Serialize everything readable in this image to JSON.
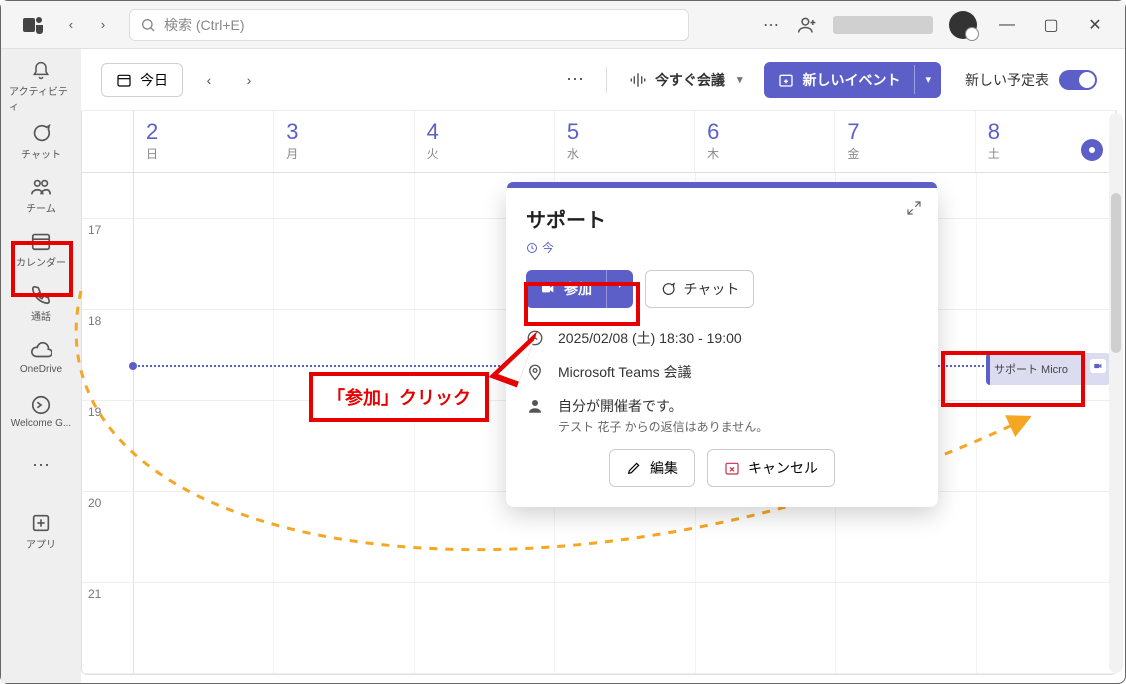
{
  "titlebar": {
    "search_placeholder": "検索 (Ctrl+E)"
  },
  "rail": {
    "items": [
      {
        "label": "アクティビティ",
        "name": "activity"
      },
      {
        "label": "チャット",
        "name": "chat"
      },
      {
        "label": "チーム",
        "name": "teams"
      },
      {
        "label": "カレンダー",
        "name": "calendar"
      },
      {
        "label": "通話",
        "name": "calls"
      },
      {
        "label": "OneDrive",
        "name": "onedrive"
      },
      {
        "label": "Welcome G...",
        "name": "welcome"
      }
    ],
    "apps_label": "アプリ"
  },
  "toolbar": {
    "today": "今日",
    "meet_now": "今すぐ会議",
    "new_event": "新しいイベント",
    "schedule_view": "新しい予定表"
  },
  "days": [
    {
      "num": "2",
      "dow": "日"
    },
    {
      "num": "3",
      "dow": "月"
    },
    {
      "num": "4",
      "dow": "火"
    },
    {
      "num": "5",
      "dow": "水"
    },
    {
      "num": "6",
      "dow": "木"
    },
    {
      "num": "7",
      "dow": "金"
    },
    {
      "num": "8",
      "dow": "土"
    }
  ],
  "hours": [
    "17",
    "18",
    "19",
    "20",
    "21"
  ],
  "event_block": {
    "title": "サポート Micro"
  },
  "popup": {
    "title": "サポート",
    "when_pill": "今",
    "join": "参加",
    "chat": "チャット",
    "datetime": "2025/02/08 (土) 18:30 - 19:00",
    "location": "Microsoft Teams 会議",
    "organizer_line": "自分が開催者です。",
    "rsvp_sub": "テスト 花子 からの返信はありません。",
    "edit": "編集",
    "cancel": "キャンセル"
  },
  "annotation": {
    "callout": "「参加」クリック"
  }
}
